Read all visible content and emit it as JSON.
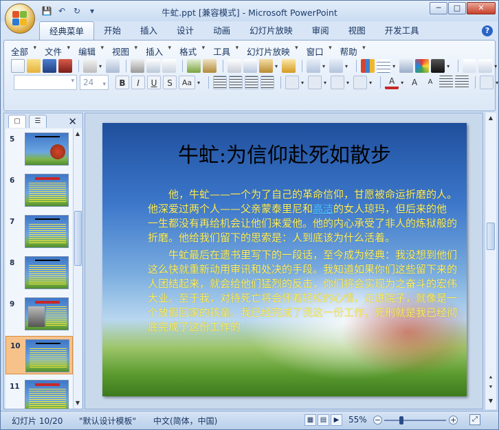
{
  "window": {
    "title": "牛虻.ppt [兼容模式] - Microsoft PowerPoint",
    "controls": [
      "─",
      "□",
      "✕"
    ]
  },
  "qat": [
    "💾",
    "↶",
    "↻"
  ],
  "ribbon_tabs": [
    "经典菜单",
    "开始",
    "插入",
    "设计",
    "动画",
    "幻灯片放映",
    "审阅",
    "视图",
    "开发工具"
  ],
  "menus": [
    "全部",
    "文件",
    "编辑",
    "视图",
    "插入",
    "格式",
    "工具",
    "幻灯片放映",
    "窗口",
    "帮助"
  ],
  "font": {
    "name": "",
    "size": "24"
  },
  "format_buttons": [
    "B",
    "I",
    "U",
    "S",
    "Aa"
  ],
  "slides_panel": {
    "thumbnails": [
      {
        "num": "5"
      },
      {
        "num": "6"
      },
      {
        "num": "7"
      },
      {
        "num": "8"
      },
      {
        "num": "9"
      },
      {
        "num": "10"
      },
      {
        "num": "11"
      }
    ]
  },
  "slide": {
    "title": "牛虻:为信仰赴死如散步",
    "p1_a": "他，牛虻——一个为了自己的革命信仰，甘愿被命运折磨的人。他深爱过两个人——父亲蒙泰里尼和",
    "p1_link": "高洁",
    "p1_b": "的女人琼玛，但后来的他一生都没有再给机会让他们来爱他。他的内心承受了非人的炼狱般的折磨。他给我们留下的思索是：人到底该为什么活着。",
    "p2": "牛虻最后在遗书里写下的一段话，至今成为经典：我没想到他们这么快就重新动用审讯和处决的手段。我知道如果你们这些留下来的人团结起来，就会给他们猛烈的反击，你们将会实现为之奋斗的宏伟大业。至于我，对待死亡将会怀着轻松的心情，走进院子，就像是一个放假回家的孩童。我已经完成了我这一份工作，死刑就是我已经彻底完成了这份工作的"
  },
  "status": {
    "slide_info": "幻灯片 10/20",
    "template": "\"默认设计模板\"",
    "language": "中文(简体，中国)",
    "zoom": "55%"
  }
}
